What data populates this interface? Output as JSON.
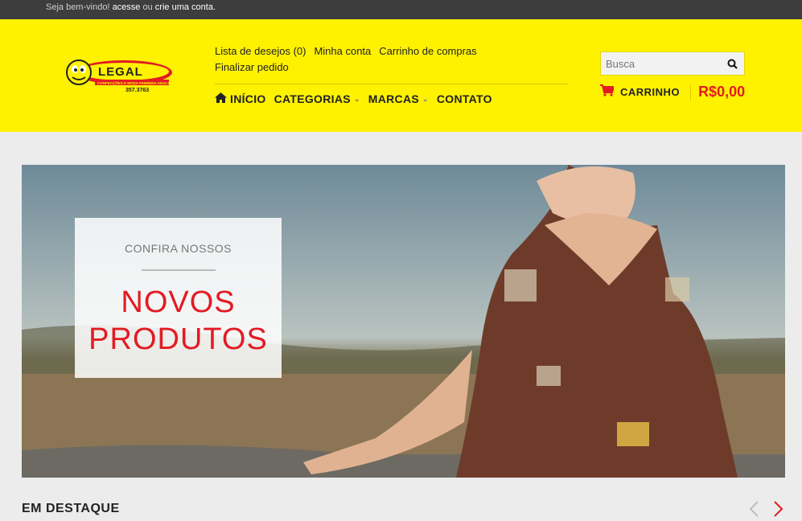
{
  "topbar": {
    "welcome": "Seja bem-vindo!",
    "login_link": "acesse",
    "or": "ou",
    "register_link": "crie uma conta."
  },
  "logo": {
    "brand_text": "LEGAL",
    "tagline": "CONFECÇÕES E MODA FEMININA ADULTA",
    "code": "357.3763"
  },
  "header_links": [
    {
      "label": "Lista de desejos (0)"
    },
    {
      "label": "Minha conta"
    },
    {
      "label": "Carrinho de compras"
    },
    {
      "label": "Finalizar pedido"
    }
  ],
  "nav": {
    "home": "INÍCIO",
    "categories": "CATEGORIAS",
    "brands": "MARCAS",
    "contact": "CONTATO"
  },
  "search": {
    "placeholder": "Busca"
  },
  "cart": {
    "label": "CARRINHO",
    "total": "R$0,00"
  },
  "banner": {
    "subtitle": "CONFIRA NOSSOS",
    "title_line1": "NOVOS",
    "title_line2": "PRODUTOS"
  },
  "featured": {
    "heading": "EM DESTAQUE"
  },
  "colors": {
    "header_bg": "#fff200",
    "accent_red": "#e31b23",
    "topbar_bg": "#3d3d3d"
  },
  "icons": {
    "home": "home-icon",
    "search": "search-icon",
    "cart": "cart-icon",
    "prev": "chevron-left-icon",
    "next": "chevron-right-icon"
  }
}
